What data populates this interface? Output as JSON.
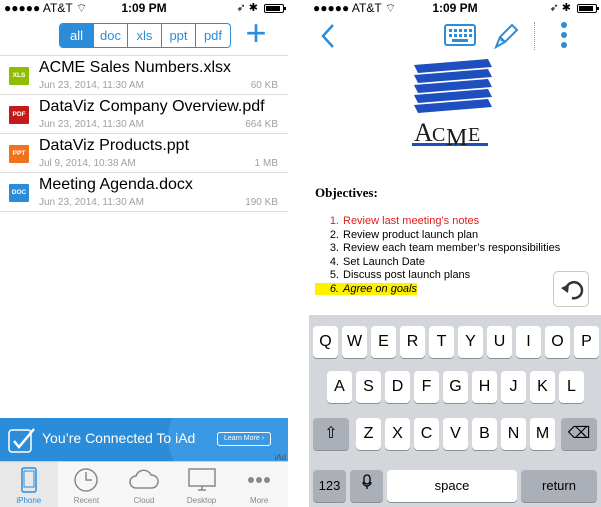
{
  "left": {
    "status": {
      "carrier": "AT&T",
      "time": "1:09 PM"
    },
    "filters": [
      "all",
      "doc",
      "xls",
      "ppt",
      "pdf"
    ],
    "active_filter": "all",
    "add_label": "+",
    "files": [
      {
        "badge": "XLS",
        "color": "#8fbe00",
        "name": "ACME Sales Numbers.xlsx",
        "date": "Jun 23, 2014, 11:30 AM",
        "size": "60 KB"
      },
      {
        "badge": "PDF",
        "color": "#c41a1a",
        "name": "DataViz Company Overview.pdf",
        "date": "Jun 23, 2014, 11:30 AM",
        "size": "664 KB"
      },
      {
        "badge": "PPT",
        "color": "#f2711c",
        "name": "DataViz Products.ppt",
        "date": "Jul 9, 2014, 10:38 AM",
        "size": "1 MB"
      },
      {
        "badge": "DOC",
        "color": "#2b8cd9",
        "name": "Meeting Agenda.docx",
        "date": "Jun 23, 2014, 11:30 AM",
        "size": "190 KB"
      }
    ],
    "ad": {
      "message": "You’re Connected To iAd",
      "learn_more": "Learn More ›",
      "tag": "iAd"
    },
    "tabs": [
      {
        "label": "iPhone",
        "icon": "iphone-icon"
      },
      {
        "label": "Recent",
        "icon": "clock-icon"
      },
      {
        "label": "Cloud",
        "icon": "cloud-icon"
      },
      {
        "label": "Desktop",
        "icon": "desktop-icon"
      },
      {
        "label": "More",
        "icon": "ellipsis-icon"
      }
    ]
  },
  "right": {
    "status": {
      "carrier": "AT&T",
      "time": "1:09 PM"
    },
    "logo": {
      "text_a": "A",
      "text_c": "C",
      "text_m": "M",
      "text_e": "E"
    },
    "doc": {
      "heading": "Objectives:",
      "items": [
        {
          "n": "1.",
          "text": "Review last meeting’s notes",
          "style": "red"
        },
        {
          "n": "2.",
          "text": "Review product launch plan",
          "style": ""
        },
        {
          "n": "3.",
          "text": "Review each team member’s responsibilities",
          "style": ""
        },
        {
          "n": "4.",
          "text": "Set Launch Date",
          "style": ""
        },
        {
          "n": "5.",
          "text": "Discuss post launch plans",
          "style": ""
        },
        {
          "n": "6.",
          "text": "Agree on goals",
          "style": "hl"
        }
      ]
    },
    "keyboard": {
      "row1": [
        "Q",
        "W",
        "E",
        "R",
        "T",
        "Y",
        "U",
        "I",
        "O",
        "P"
      ],
      "row2": [
        "A",
        "S",
        "D",
        "F",
        "G",
        "H",
        "J",
        "K",
        "L"
      ],
      "row3": [
        "Z",
        "X",
        "C",
        "V",
        "B",
        "N",
        "M"
      ],
      "numbers": "123",
      "space": "space",
      "return": "return"
    }
  }
}
